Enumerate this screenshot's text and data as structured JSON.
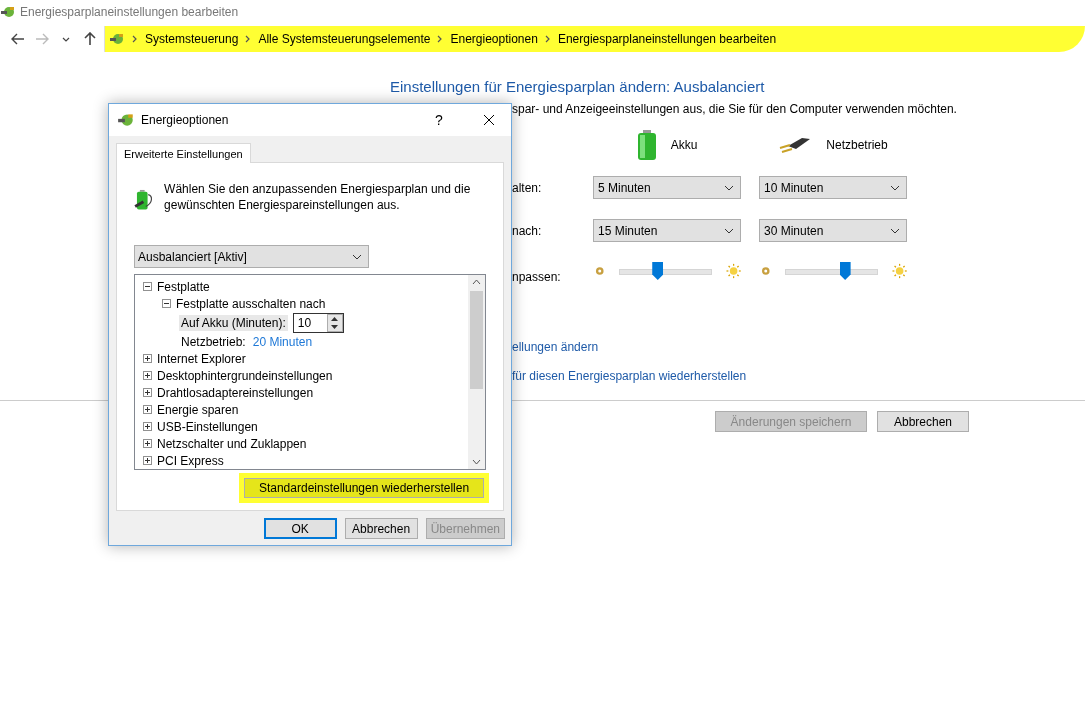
{
  "window": {
    "title": "Energiesparplaneinstellungen bearbeiten"
  },
  "nav": {
    "buttons": [
      {
        "kind": "back",
        "disabled": false
      },
      {
        "kind": "forward",
        "disabled": true
      },
      {
        "kind": "recent",
        "disabled": false
      },
      {
        "kind": "up",
        "disabled": false
      }
    ],
    "breadcrumb": {
      "highlighted": true,
      "items": [
        "Systemsteuerung",
        "Alle Systemsteuerungselemente",
        "Energieoptionen",
        "Energiesparplaneinstellungen bearbeiten"
      ]
    }
  },
  "page": {
    "heading": "Einstellungen für Energiesparplan ändern: Ausbalanciert",
    "intro": "spar- und Anzeigeeinstellungen aus, die Sie für den Computer verwenden möchten.",
    "columns": [
      {
        "kind": "battery",
        "label": "Akku"
      },
      {
        "kind": "plug",
        "label": "Netzbetrieb"
      }
    ],
    "rows": [
      {
        "kind": "select",
        "label": "alten:",
        "values": [
          "5 Minuten",
          "10 Minuten"
        ]
      },
      {
        "kind": "select",
        "label": "nach:",
        "values": [
          "15 Minuten",
          "30 Minuten"
        ]
      },
      {
        "kind": "slider",
        "label": "npassen:",
        "sliders": [
          {
            "level": 0.41
          },
          {
            "level": 0.67
          }
        ]
      }
    ],
    "links": [
      "ellungen ändern",
      "für diesen Energiesparplan wiederherstellen"
    ],
    "buttons": [
      {
        "label": "Änderungen speichern",
        "disabled": true
      },
      {
        "label": "Abbrechen",
        "disabled": false
      }
    ]
  },
  "dialog": {
    "title": "Energieoptionen",
    "help": "?",
    "tabs": [
      {
        "label": "Erweiterte Einstellungen",
        "selected": true
      }
    ],
    "intro": "Wählen Sie den anzupassenden Energiesparplan und die gewünschten Energiespareinstellungen aus.",
    "plan": "Ausbalanciert [Aktiv]",
    "tree": [
      {
        "kind": "group",
        "label": "Festplatte",
        "expanded": true,
        "children": [
          {
            "kind": "group",
            "label": "Festplatte ausschalten nach",
            "expanded": true,
            "children": [
              {
                "kind": "spinner",
                "label": "Auf Akku (Minuten):",
                "value": "10",
                "selected": true
              },
              {
                "kind": "value",
                "label": "Netzbetrieb:",
                "value": "20 Minuten",
                "selected": false
              }
            ]
          }
        ]
      },
      {
        "kind": "group",
        "label": "Internet Explorer",
        "expanded": false
      },
      {
        "kind": "group",
        "label": "Desktophintergrundeinstellungen",
        "expanded": false
      },
      {
        "kind": "group",
        "label": "Drahtlosadaptereinstellungen",
        "expanded": false
      },
      {
        "kind": "group",
        "label": "Energie sparen",
        "expanded": false
      },
      {
        "kind": "group",
        "label": "USB-Einstellungen",
        "expanded": false
      },
      {
        "kind": "group",
        "label": "Netzschalter und Zuklappen",
        "expanded": false
      },
      {
        "kind": "group",
        "label": "PCI Express",
        "expanded": false
      }
    ],
    "restore": {
      "label": "Standardeinstellungen wiederherstellen",
      "highlighted": true
    },
    "buttons": [
      {
        "label": "OK",
        "disabled": false,
        "default": true
      },
      {
        "label": "Abbrechen",
        "disabled": false,
        "default": false
      },
      {
        "label": "Übernehmen",
        "disabled": true,
        "default": false
      }
    ]
  }
}
